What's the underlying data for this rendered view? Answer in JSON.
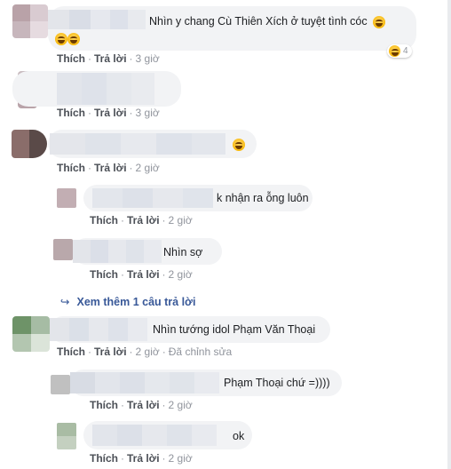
{
  "comments": [
    {
      "text": "Nhìn y chang Cù Thiên Xích ở tuyệt tình cóc",
      "emoji": "grinning-squint-emoji",
      "like": "Thích",
      "reply": "Trả lời",
      "time": "3 giờ",
      "reaction_count": "4"
    },
    {
      "text": "",
      "like": "Thích",
      "reply": "Trả lời",
      "time": "3 giờ"
    },
    {
      "text": "",
      "emoji": "grinning-emoji",
      "like": "Thích",
      "reply": "Trả lời",
      "time": "2 giờ"
    },
    {
      "text": "k nhận ra ỗng luôn",
      "like": "Thích",
      "reply": "Trả lời",
      "time": "2 giờ"
    },
    {
      "text": "Nhìn sợ",
      "like": "Thích",
      "reply": "Trả lời",
      "time": "2 giờ"
    },
    {
      "text": "Nhìn tướng idol Phạm Văn Thoại",
      "like": "Thích",
      "reply": "Trả lời",
      "time": "2 giờ",
      "edited": "Đã chỉnh sửa"
    },
    {
      "text": "Phạm Thoại chứ =))))",
      "like": "Thích",
      "reply": "Trả lời",
      "time": "2 giờ"
    },
    {
      "text": "ok",
      "like": "Thích",
      "reply": "Trả lời",
      "time": "2 giờ"
    }
  ],
  "more_replies": "Xem thêm 1 câu trả lời",
  "colors": {
    "link": "#385898",
    "bubble": "#f2f3f5",
    "meta": "#90949c",
    "action": "#4b4f56"
  }
}
